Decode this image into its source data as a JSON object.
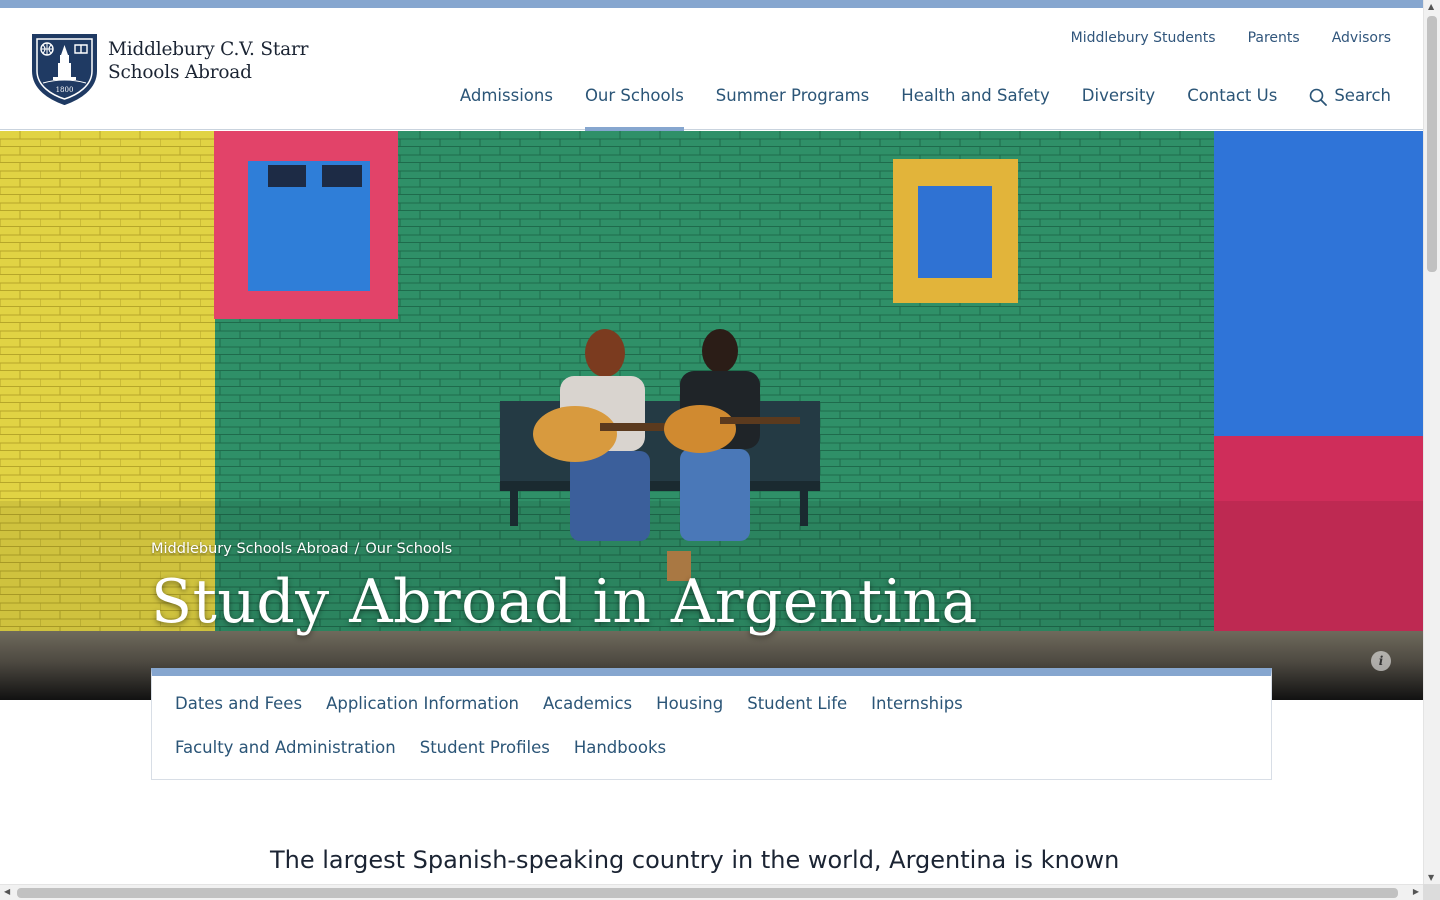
{
  "header": {
    "logo_line1": "Middlebury C.V. Starr",
    "logo_line2": "Schools Abroad",
    "crest_year": "1800",
    "utility_nav": [
      "Middlebury Students",
      "Parents",
      "Advisors"
    ],
    "main_nav": [
      "Admissions",
      "Our Schools",
      "Summer Programs",
      "Health and Safety",
      "Diversity",
      "Contact Us"
    ],
    "active_nav": "Our Schools",
    "search_label": "Search"
  },
  "hero": {
    "breadcrumb": [
      "Middlebury Schools Abroad",
      "/",
      "Our Schools"
    ],
    "title": "Study Abroad in Argentina",
    "info_icon": "i"
  },
  "subnav": {
    "items": [
      "Dates and Fees",
      "Application Information",
      "Academics",
      "Housing",
      "Student Life",
      "Internships",
      "Faculty and Administration",
      "Student Profiles",
      "Handbooks"
    ]
  },
  "intro_text": "The largest Spanish-speaking country in the world, Argentina is known",
  "colors": {
    "accent": "#86a6cf",
    "nav_link": "#2b5577",
    "brand_navy": "#1f3a63"
  }
}
